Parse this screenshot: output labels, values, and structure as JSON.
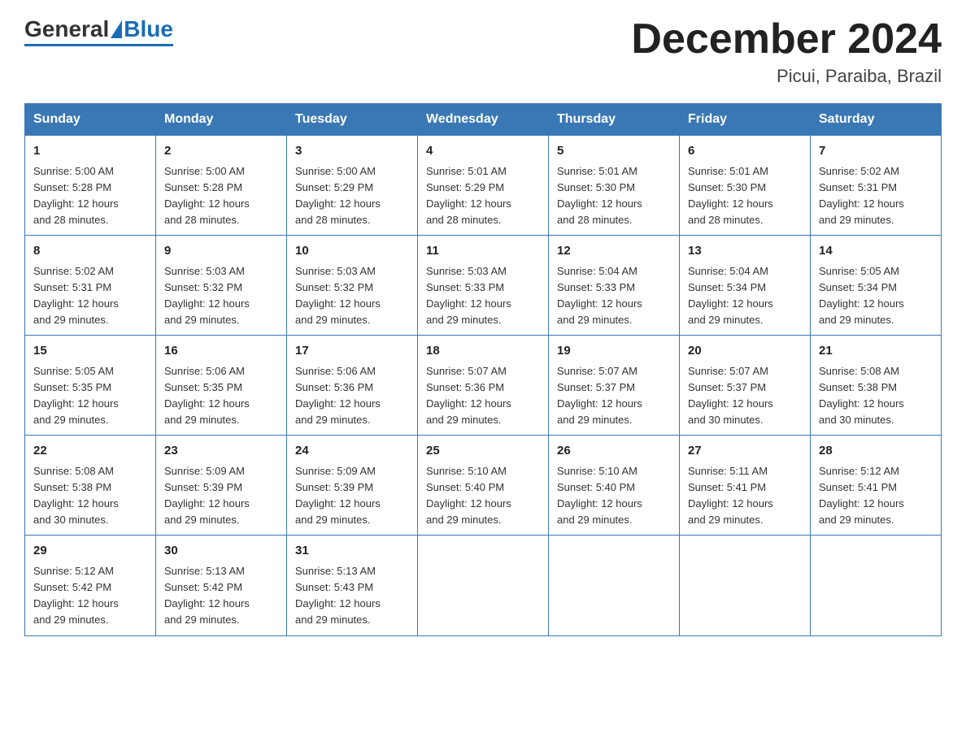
{
  "header": {
    "logo_general": "General",
    "logo_blue": "Blue",
    "month_title": "December 2024",
    "location": "Picui, Paraiba, Brazil"
  },
  "weekdays": [
    "Sunday",
    "Monday",
    "Tuesday",
    "Wednesday",
    "Thursday",
    "Friday",
    "Saturday"
  ],
  "weeks": [
    [
      {
        "day": "1",
        "sunrise": "5:00 AM",
        "sunset": "5:28 PM",
        "daylight": "12 hours and 28 minutes."
      },
      {
        "day": "2",
        "sunrise": "5:00 AM",
        "sunset": "5:28 PM",
        "daylight": "12 hours and 28 minutes."
      },
      {
        "day": "3",
        "sunrise": "5:00 AM",
        "sunset": "5:29 PM",
        "daylight": "12 hours and 28 minutes."
      },
      {
        "day": "4",
        "sunrise": "5:01 AM",
        "sunset": "5:29 PM",
        "daylight": "12 hours and 28 minutes."
      },
      {
        "day": "5",
        "sunrise": "5:01 AM",
        "sunset": "5:30 PM",
        "daylight": "12 hours and 28 minutes."
      },
      {
        "day": "6",
        "sunrise": "5:01 AM",
        "sunset": "5:30 PM",
        "daylight": "12 hours and 28 minutes."
      },
      {
        "day": "7",
        "sunrise": "5:02 AM",
        "sunset": "5:31 PM",
        "daylight": "12 hours and 29 minutes."
      }
    ],
    [
      {
        "day": "8",
        "sunrise": "5:02 AM",
        "sunset": "5:31 PM",
        "daylight": "12 hours and 29 minutes."
      },
      {
        "day": "9",
        "sunrise": "5:03 AM",
        "sunset": "5:32 PM",
        "daylight": "12 hours and 29 minutes."
      },
      {
        "day": "10",
        "sunrise": "5:03 AM",
        "sunset": "5:32 PM",
        "daylight": "12 hours and 29 minutes."
      },
      {
        "day": "11",
        "sunrise": "5:03 AM",
        "sunset": "5:33 PM",
        "daylight": "12 hours and 29 minutes."
      },
      {
        "day": "12",
        "sunrise": "5:04 AM",
        "sunset": "5:33 PM",
        "daylight": "12 hours and 29 minutes."
      },
      {
        "day": "13",
        "sunrise": "5:04 AM",
        "sunset": "5:34 PM",
        "daylight": "12 hours and 29 minutes."
      },
      {
        "day": "14",
        "sunrise": "5:05 AM",
        "sunset": "5:34 PM",
        "daylight": "12 hours and 29 minutes."
      }
    ],
    [
      {
        "day": "15",
        "sunrise": "5:05 AM",
        "sunset": "5:35 PM",
        "daylight": "12 hours and 29 minutes."
      },
      {
        "day": "16",
        "sunrise": "5:06 AM",
        "sunset": "5:35 PM",
        "daylight": "12 hours and 29 minutes."
      },
      {
        "day": "17",
        "sunrise": "5:06 AM",
        "sunset": "5:36 PM",
        "daylight": "12 hours and 29 minutes."
      },
      {
        "day": "18",
        "sunrise": "5:07 AM",
        "sunset": "5:36 PM",
        "daylight": "12 hours and 29 minutes."
      },
      {
        "day": "19",
        "sunrise": "5:07 AM",
        "sunset": "5:37 PM",
        "daylight": "12 hours and 29 minutes."
      },
      {
        "day": "20",
        "sunrise": "5:07 AM",
        "sunset": "5:37 PM",
        "daylight": "12 hours and 30 minutes."
      },
      {
        "day": "21",
        "sunrise": "5:08 AM",
        "sunset": "5:38 PM",
        "daylight": "12 hours and 30 minutes."
      }
    ],
    [
      {
        "day": "22",
        "sunrise": "5:08 AM",
        "sunset": "5:38 PM",
        "daylight": "12 hours and 30 minutes."
      },
      {
        "day": "23",
        "sunrise": "5:09 AM",
        "sunset": "5:39 PM",
        "daylight": "12 hours and 29 minutes."
      },
      {
        "day": "24",
        "sunrise": "5:09 AM",
        "sunset": "5:39 PM",
        "daylight": "12 hours and 29 minutes."
      },
      {
        "day": "25",
        "sunrise": "5:10 AM",
        "sunset": "5:40 PM",
        "daylight": "12 hours and 29 minutes."
      },
      {
        "day": "26",
        "sunrise": "5:10 AM",
        "sunset": "5:40 PM",
        "daylight": "12 hours and 29 minutes."
      },
      {
        "day": "27",
        "sunrise": "5:11 AM",
        "sunset": "5:41 PM",
        "daylight": "12 hours and 29 minutes."
      },
      {
        "day": "28",
        "sunrise": "5:12 AM",
        "sunset": "5:41 PM",
        "daylight": "12 hours and 29 minutes."
      }
    ],
    [
      {
        "day": "29",
        "sunrise": "5:12 AM",
        "sunset": "5:42 PM",
        "daylight": "12 hours and 29 minutes."
      },
      {
        "day": "30",
        "sunrise": "5:13 AM",
        "sunset": "5:42 PM",
        "daylight": "12 hours and 29 minutes."
      },
      {
        "day": "31",
        "sunrise": "5:13 AM",
        "sunset": "5:43 PM",
        "daylight": "12 hours and 29 minutes."
      },
      null,
      null,
      null,
      null
    ]
  ],
  "labels": {
    "sunrise": "Sunrise:",
    "sunset": "Sunset:",
    "daylight": "Daylight:"
  }
}
